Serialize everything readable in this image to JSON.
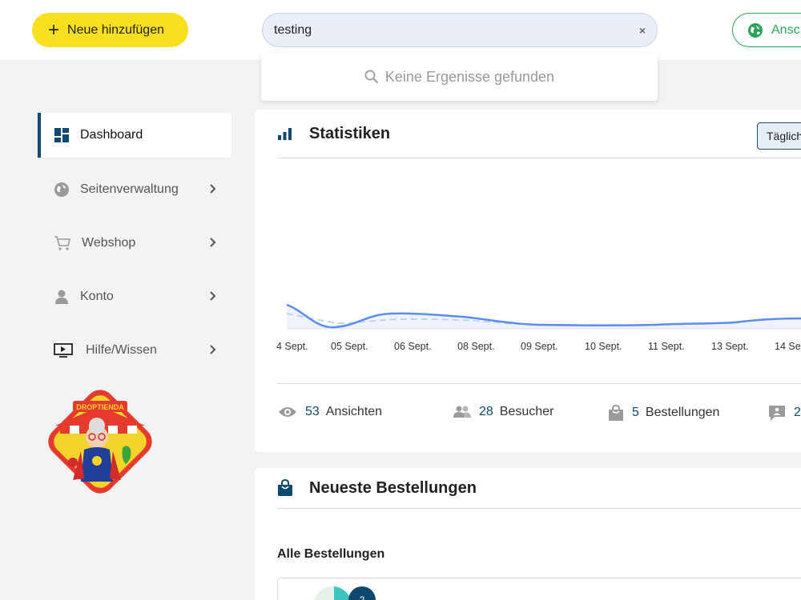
{
  "topbar": {
    "add_label": "Neue hinzufügen",
    "search_value": "testing",
    "search_clear": "×",
    "view_label": "Ansc"
  },
  "search_dropdown": {
    "no_results": "Keine Ergenisse gefunden"
  },
  "sidebar": {
    "items": [
      {
        "label": "Dashboard",
        "icon": "dashboard-icon",
        "active": true
      },
      {
        "label": "Seitenverwaltung",
        "icon": "globe-icon"
      },
      {
        "label": "Webshop",
        "icon": "cart-icon"
      },
      {
        "label": "Konto",
        "icon": "user-icon"
      },
      {
        "label": "Hilfe/Wissen",
        "icon": "video-icon"
      }
    ],
    "logo_text": "DROPTIENDA"
  },
  "stats": {
    "title": "Statistiken",
    "period_label": "Täglich",
    "ticks": [
      "4 Sept.",
      "05 Sept.",
      "06 Sept.",
      "08 Sept.",
      "09 Sept.",
      "10 Sept.",
      "11 Sept.",
      "13 Sept.",
      "14 Se"
    ],
    "metrics": [
      {
        "value": "53",
        "label": "Ansichten",
        "icon": "eye-icon"
      },
      {
        "value": "28",
        "label": "Besucher",
        "icon": "users-icon"
      },
      {
        "value": "5",
        "label": "Bestellungen",
        "icon": "bag-icon"
      },
      {
        "value": "2",
        "label": "",
        "icon": "comment-icon"
      }
    ]
  },
  "orders": {
    "title": "Neueste Bestellungen",
    "subtitle": "Alle Bestellungen",
    "badge": "2"
  },
  "colors": {
    "accent": "#0f4a6e",
    "add_button": "#f8e01e",
    "view_button": "#2aa55a",
    "line": "#5b8def"
  }
}
